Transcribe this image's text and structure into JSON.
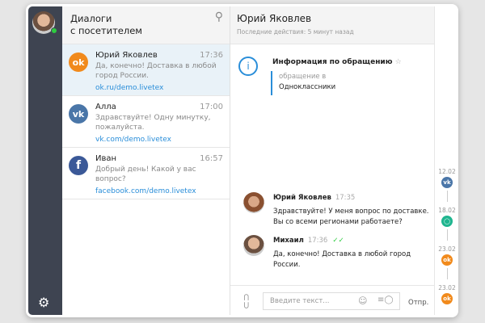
{
  "sidebar": {
    "status": "online",
    "settings_icon": "gear-icon"
  },
  "list": {
    "title_line1": "Диалоги",
    "title_line2": "с посетителем",
    "items": [
      {
        "name": "Юрий Яковлев",
        "time": "17:36",
        "preview": "Да, конечно! Доставка в любой город России.",
        "link": "ok.ru/demo.livetex",
        "channel": "odnoklassniki",
        "color": "#f18a1c"
      },
      {
        "name": "Алла",
        "time": "17:00",
        "preview": "Здравствуйте! Одну минутку, пожалуйста.",
        "link": "vk.com/demo.livetex",
        "channel": "vk",
        "color": "#4a76a8"
      },
      {
        "name": "Иван",
        "time": "16:57",
        "preview": "Добрый день! Какой у вас вопрос?",
        "link": "facebook.com/demo.livetex",
        "channel": "facebook",
        "color": "#3b5998"
      }
    ]
  },
  "chat": {
    "title": "Юрий Яковлев",
    "subtitle": "Последние действия: 5 минут назад",
    "info": {
      "title": "Информация по обращению",
      "label": "обращение в",
      "value": "Одноклассники"
    },
    "messages": [
      {
        "author": "Юрий Яковлев",
        "time": "17:35",
        "text": "Здравствуйте! У меня вопрос по доставке. Вы со всеми регионами работаете?"
      },
      {
        "author": "Михаил",
        "time": "17:36",
        "text": "Да, конечно! Доставка в любой город России.",
        "read": "✓✓"
      }
    ],
    "input_placeholder": "Введите текст...",
    "send_label": "Отпр."
  },
  "timeline": [
    {
      "date": "12.02",
      "channel": "vk",
      "color": "#4a76a8"
    },
    {
      "date": "18.02",
      "channel": "chat",
      "color": "#1fb58f"
    },
    {
      "date": "23.02",
      "channel": "odnoklassniki",
      "color": "#f18a1c"
    },
    {
      "date": "23.02",
      "channel": "odnoklassniki",
      "color": "#f18a1c"
    }
  ]
}
